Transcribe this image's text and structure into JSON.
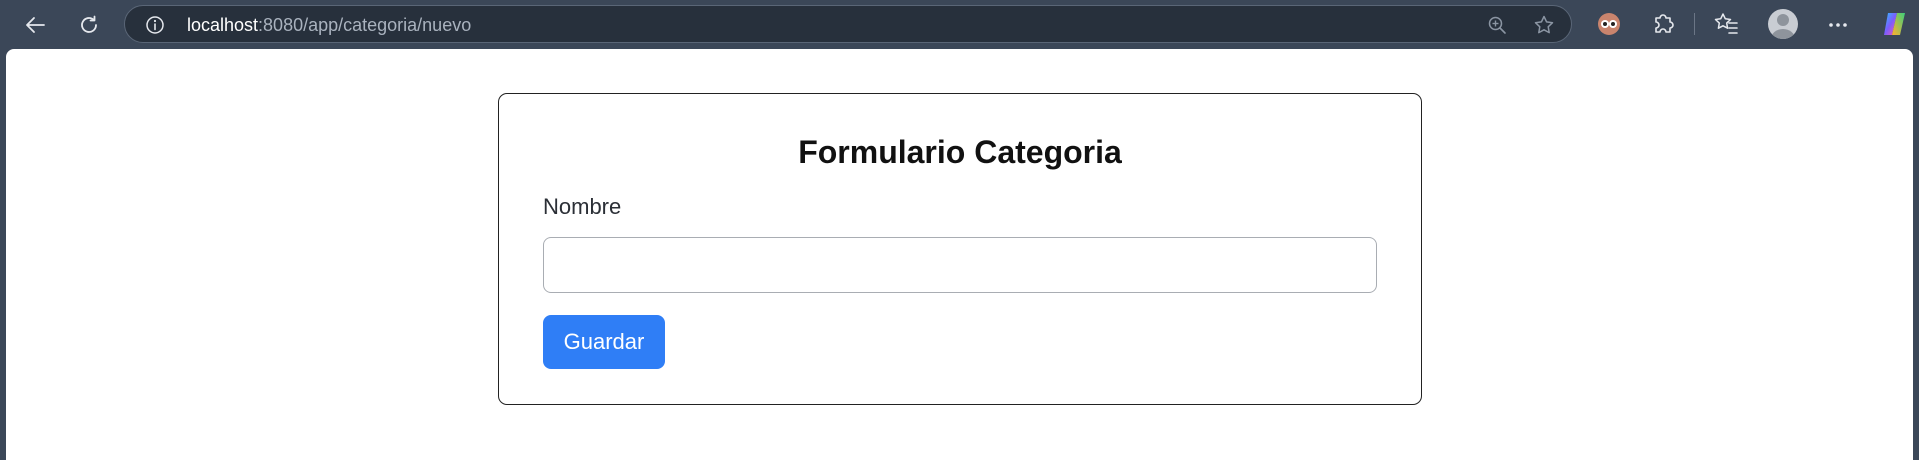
{
  "browser": {
    "url_host": "localhost",
    "url_path": ":8080/app/categoria/nuevo",
    "icons": {
      "back": "back-arrow-icon",
      "reload": "reload-icon",
      "info": "info-icon",
      "zoom": "zoom-icon",
      "favorite": "star-icon",
      "extension_owl": "owl-extension-icon",
      "extensions": "puzzle-icon",
      "favorites": "favorites-icon",
      "profile": "avatar-icon",
      "more": "more-icon",
      "copilot": "copilot-icon"
    }
  },
  "form": {
    "title": "Formulario Categoria",
    "name_label": "Nombre",
    "name_value": "",
    "name_placeholder": "",
    "submit_label": "Guardar"
  },
  "colors": {
    "browser_chrome": "#3b4758",
    "primary_button": "#2f7ef6",
    "card_border": "#222222"
  }
}
